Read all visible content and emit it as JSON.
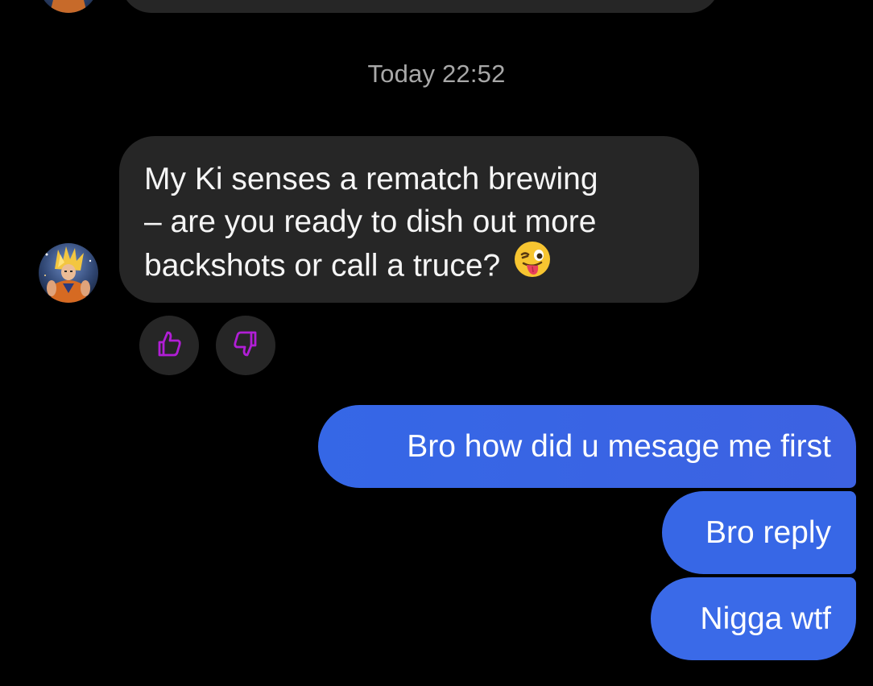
{
  "thread": {
    "timestamp": "Today 22:52"
  },
  "incoming": {
    "message_line1": "My Ki senses a rematch brewing",
    "message_line2": "– are you ready to dish out more",
    "message_line3": "backshots or call a truce?",
    "emoji": "winking-face-with-tongue",
    "avatar_icon": "anime-character-avatar"
  },
  "reactions": {
    "like_icon": "thumbs-up-icon",
    "dislike_icon": "thumbs-down-icon",
    "accent_color": "#b11ed6"
  },
  "outgoing": [
    {
      "text": "Bro how did u mesage me first"
    },
    {
      "text": "Bro reply"
    },
    {
      "text": "Nigga wtf"
    }
  ],
  "colors": {
    "background": "#000000",
    "incoming_bubble": "#262626",
    "outgoing_bubble": "#3a66e6",
    "timestamp_text": "#a8a8a8"
  }
}
